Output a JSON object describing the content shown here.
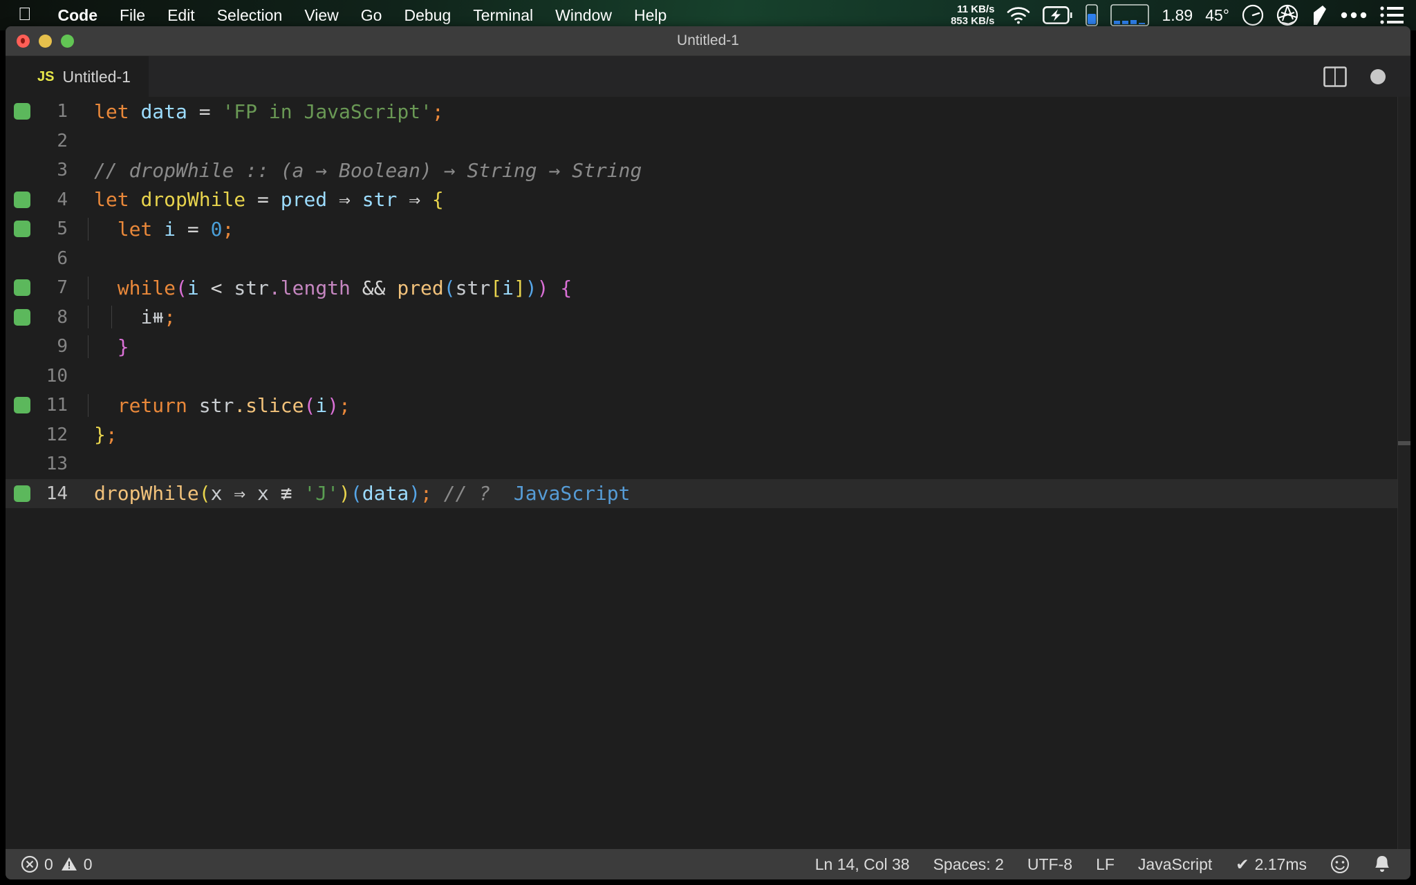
{
  "menubar": {
    "apple_icon": "apple-logo-icon",
    "items": [
      {
        "label": "Code",
        "bold": true
      },
      {
        "label": "File",
        "bold": false
      },
      {
        "label": "Edit",
        "bold": false
      },
      {
        "label": "Selection",
        "bold": false
      },
      {
        "label": "View",
        "bold": false
      },
      {
        "label": "Go",
        "bold": false
      },
      {
        "label": "Debug",
        "bold": false
      },
      {
        "label": "Terminal",
        "bold": false
      },
      {
        "label": "Window",
        "bold": false
      },
      {
        "label": "Help",
        "bold": false
      }
    ],
    "network_up": "11 KB/s",
    "network_down": "853 KB/s",
    "load_value": "1.89",
    "temperature": "45°",
    "icons": [
      "wifi-icon",
      "battery-charging-icon",
      "memory-gauge-icon",
      "cpu-history-icon",
      "speedometer-icon",
      "aperture-icon",
      "flag-icon",
      "ellipsis-icon",
      "list-icon"
    ]
  },
  "window": {
    "title": "Untitled-1",
    "traffic_lights": [
      "close-button",
      "minimize-button",
      "zoom-button"
    ]
  },
  "tab": {
    "badge": "JS",
    "label": "Untitled-1",
    "split_icon": "split-editor-icon",
    "dirty_icon": "unsaved-dot-icon"
  },
  "editor": {
    "lines": [
      {
        "num": "1",
        "mark": true,
        "current": false,
        "tokens": [
          {
            "t": "let",
            "c": "t-key"
          },
          {
            "t": " ",
            "c": "t-plain"
          },
          {
            "t": "data",
            "c": "t-var"
          },
          {
            "t": " ",
            "c": "t-plain"
          },
          {
            "t": "=",
            "c": "t-op"
          },
          {
            "t": " ",
            "c": "t-plain"
          },
          {
            "t": "'FP in JavaScript'",
            "c": "t-str"
          },
          {
            "t": ";",
            "c": "t-semi"
          }
        ]
      },
      {
        "num": "2",
        "mark": false,
        "current": false,
        "tokens": []
      },
      {
        "num": "3",
        "mark": false,
        "current": false,
        "tokens": [
          {
            "t": "// dropWhile :: (a → Boolean) → String → String",
            "c": "t-comment"
          }
        ]
      },
      {
        "num": "4",
        "mark": true,
        "current": false,
        "tokens": [
          {
            "t": "let",
            "c": "t-key"
          },
          {
            "t": " ",
            "c": "t-plain"
          },
          {
            "t": "dropWhile",
            "c": "t-fnyellow"
          },
          {
            "t": " ",
            "c": "t-plain"
          },
          {
            "t": "=",
            "c": "t-op"
          },
          {
            "t": " ",
            "c": "t-plain"
          },
          {
            "t": "pred",
            "c": "t-var"
          },
          {
            "t": " ",
            "c": "t-plain"
          },
          {
            "t": "⇒",
            "c": "t-op"
          },
          {
            "t": " ",
            "c": "t-plain"
          },
          {
            "t": "str",
            "c": "t-var"
          },
          {
            "t": " ",
            "c": "t-plain"
          },
          {
            "t": "⇒",
            "c": "t-op"
          },
          {
            "t": " ",
            "c": "t-plain"
          },
          {
            "t": "{",
            "c": "t-b1"
          }
        ]
      },
      {
        "num": "5",
        "mark": true,
        "current": false,
        "tokens": [
          {
            "t": "  ",
            "c": "t-plain"
          },
          {
            "t": "let",
            "c": "t-key"
          },
          {
            "t": " ",
            "c": "t-plain"
          },
          {
            "t": "i",
            "c": "t-var"
          },
          {
            "t": " ",
            "c": "t-plain"
          },
          {
            "t": "=",
            "c": "t-op"
          },
          {
            "t": " ",
            "c": "t-plain"
          },
          {
            "t": "0",
            "c": "t-num"
          },
          {
            "t": ";",
            "c": "t-semi"
          }
        ]
      },
      {
        "num": "6",
        "mark": false,
        "current": false,
        "tokens": []
      },
      {
        "num": "7",
        "mark": true,
        "current": false,
        "tokens": [
          {
            "t": "  ",
            "c": "t-plain"
          },
          {
            "t": "while",
            "c": "t-key"
          },
          {
            "t": "(",
            "c": "t-b2"
          },
          {
            "t": "i",
            "c": "t-var"
          },
          {
            "t": " ",
            "c": "t-plain"
          },
          {
            "t": "<",
            "c": "t-op"
          },
          {
            "t": " ",
            "c": "t-plain"
          },
          {
            "t": "str",
            "c": "t-plain"
          },
          {
            "t": ".length",
            "c": "t-prop"
          },
          {
            "t": " ",
            "c": "t-plain"
          },
          {
            "t": "&&",
            "c": "t-op"
          },
          {
            "t": " ",
            "c": "t-plain"
          },
          {
            "t": "pred",
            "c": "t-fn"
          },
          {
            "t": "(",
            "c": "t-b3"
          },
          {
            "t": "str",
            "c": "t-plain"
          },
          {
            "t": "[",
            "c": "t-b1"
          },
          {
            "t": "i",
            "c": "t-var"
          },
          {
            "t": "]",
            "c": "t-b1"
          },
          {
            "t": ")",
            "c": "t-b3"
          },
          {
            "t": ")",
            "c": "t-b2"
          },
          {
            "t": " ",
            "c": "t-plain"
          },
          {
            "t": "{",
            "c": "t-b2"
          }
        ]
      },
      {
        "num": "8",
        "mark": true,
        "current": false,
        "tokens": [
          {
            "t": "    ",
            "c": "t-plain"
          },
          {
            "t": "i⧻",
            "c": "t-plain"
          },
          {
            "t": ";",
            "c": "t-semi"
          }
        ]
      },
      {
        "num": "9",
        "mark": false,
        "current": false,
        "tokens": [
          {
            "t": "  ",
            "c": "t-plain"
          },
          {
            "t": "}",
            "c": "t-b2"
          }
        ]
      },
      {
        "num": "10",
        "mark": false,
        "current": false,
        "tokens": []
      },
      {
        "num": "11",
        "mark": true,
        "current": false,
        "tokens": [
          {
            "t": "  ",
            "c": "t-plain"
          },
          {
            "t": "return",
            "c": "t-key"
          },
          {
            "t": " ",
            "c": "t-plain"
          },
          {
            "t": "str",
            "c": "t-plain"
          },
          {
            "t": ".slice",
            "c": "t-fn"
          },
          {
            "t": "(",
            "c": "t-b2"
          },
          {
            "t": "i",
            "c": "t-var"
          },
          {
            "t": ")",
            "c": "t-b2"
          },
          {
            "t": ";",
            "c": "t-semi"
          }
        ]
      },
      {
        "num": "12",
        "mark": false,
        "current": false,
        "tokens": [
          {
            "t": "}",
            "c": "t-b1"
          },
          {
            "t": ";",
            "c": "t-semi"
          }
        ]
      },
      {
        "num": "13",
        "mark": false,
        "current": false,
        "tokens": []
      },
      {
        "num": "14",
        "mark": true,
        "current": true,
        "tokens": [
          {
            "t": "dropWhile",
            "c": "t-fn"
          },
          {
            "t": "(",
            "c": "t-b1"
          },
          {
            "t": "x",
            "c": "t-plain"
          },
          {
            "t": " ",
            "c": "t-plain"
          },
          {
            "t": "⇒",
            "c": "t-op"
          },
          {
            "t": " ",
            "c": "t-plain"
          },
          {
            "t": "x",
            "c": "t-plain"
          },
          {
            "t": " ",
            "c": "t-plain"
          },
          {
            "t": "≢",
            "c": "t-op"
          },
          {
            "t": " ",
            "c": "t-plain"
          },
          {
            "t": "'J'",
            "c": "t-str2"
          },
          {
            "t": ")",
            "c": "t-b1"
          },
          {
            "t": "(",
            "c": "t-b3"
          },
          {
            "t": "data",
            "c": "t-var"
          },
          {
            "t": ")",
            "c": "t-b3"
          },
          {
            "t": ";",
            "c": "t-semi"
          },
          {
            "t": " ",
            "c": "t-plain"
          },
          {
            "t": "// ?",
            "c": "t-comment"
          },
          {
            "t": "  ",
            "c": "t-plain"
          },
          {
            "t": "JavaScript",
            "c": "t-result"
          }
        ]
      }
    ]
  },
  "statusbar": {
    "errors": "0",
    "warnings": "0",
    "cursor": "Ln 14, Col 38",
    "indent": "Spaces: 2",
    "encoding": "UTF-8",
    "eol": "LF",
    "language": "JavaScript",
    "timing": "2.17ms",
    "timing_check": "✔",
    "smiley_icon": "feedback-smiley-icon",
    "bell_icon": "notifications-bell-icon"
  }
}
